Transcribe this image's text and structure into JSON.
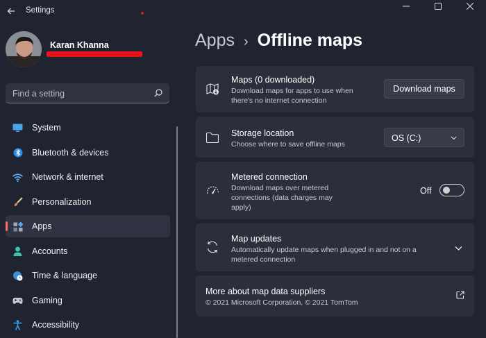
{
  "window": {
    "title": "Settings",
    "controls": [
      "minimize-icon",
      "maximize-icon",
      "close-icon"
    ]
  },
  "profile": {
    "name": "Karan Khanna"
  },
  "search": {
    "placeholder": "Find a setting"
  },
  "sidebar": {
    "items": [
      {
        "label": "System",
        "icon": "monitor-icon",
        "active": false
      },
      {
        "label": "Bluetooth & devices",
        "icon": "bluetooth-icon",
        "active": false
      },
      {
        "label": "Network & internet",
        "icon": "wifi-icon",
        "active": false
      },
      {
        "label": "Personalization",
        "icon": "paintbrush-icon",
        "active": false
      },
      {
        "label": "Apps",
        "icon": "apps-icon",
        "active": true
      },
      {
        "label": "Accounts",
        "icon": "person-icon",
        "active": false
      },
      {
        "label": "Time & language",
        "icon": "globe-clock-icon",
        "active": false
      },
      {
        "label": "Gaming",
        "icon": "gamepad-icon",
        "active": false
      },
      {
        "label": "Accessibility",
        "icon": "accessibility-icon",
        "active": false
      }
    ]
  },
  "breadcrumb": {
    "parent": "Apps",
    "separator": "›",
    "current": "Offline maps"
  },
  "cards": {
    "maps": {
      "title": "Maps (0 downloaded)",
      "desc_line1": "Download maps for apps to use when",
      "desc_line2": "there's no internet connection",
      "button": "Download maps"
    },
    "storage": {
      "title": "Storage location",
      "desc": "Choose where to save offline maps",
      "selected": "OS (C:)"
    },
    "metered": {
      "title": "Metered connection",
      "desc_line1": "Download maps over metered",
      "desc_line2": "connections (data charges may",
      "desc_line3": "apply)",
      "toggle_state": "Off",
      "toggle_on": false
    },
    "updates": {
      "title": "Map updates",
      "desc_line1": "Automatically update maps when plugged in and not on a",
      "desc_line2": "metered connection"
    },
    "suppliers": {
      "title": "More about map data suppliers",
      "copyright": "© 2021 Microsoft Corporation, © 2021 TomTom"
    }
  },
  "colors": {
    "background": "#202431",
    "card": "#2c2f3b",
    "accent": "#ff6a6a",
    "redaction": "#e8121b"
  }
}
